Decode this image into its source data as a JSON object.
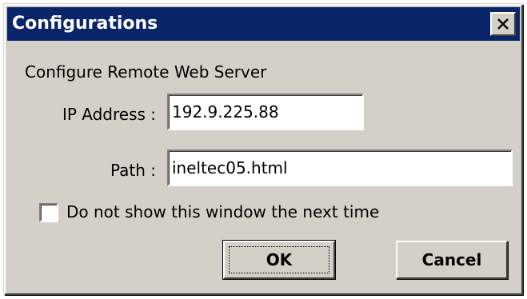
{
  "window": {
    "title": "Configurations",
    "close_icon": "close-icon"
  },
  "form": {
    "heading": "Configure Remote Web Server",
    "ip_label": "IP Address :",
    "ip_value": "192.9.225.88",
    "path_label": "Path :",
    "path_value": "ineltec05.html",
    "checkbox_label": "Do not show this window the next time",
    "checkbox_checked": false
  },
  "buttons": {
    "ok_label": "OK",
    "cancel_label": "Cancel"
  },
  "colors": {
    "titlebar": "#0a246a",
    "face": "#d4d0c8"
  }
}
